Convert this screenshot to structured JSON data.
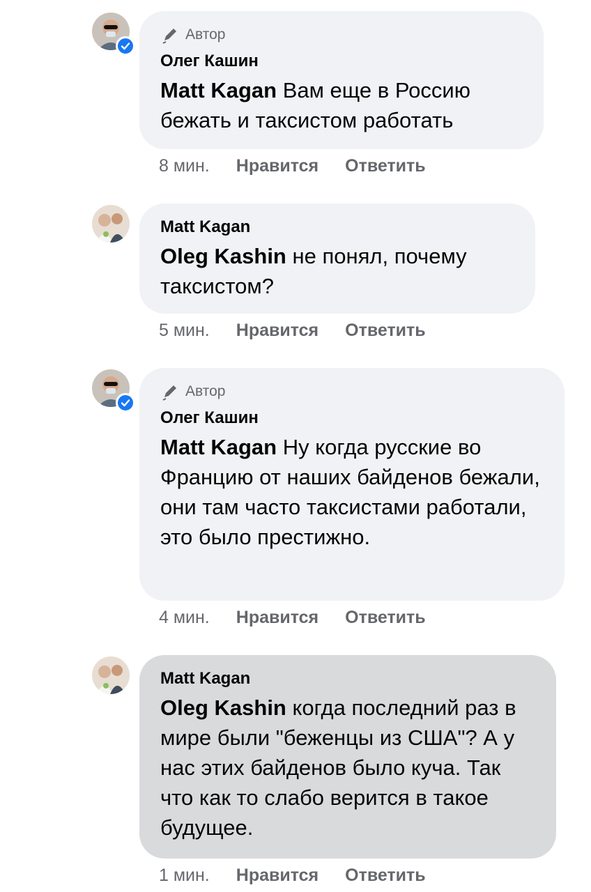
{
  "comments": [
    {
      "author_tag": "Автор",
      "name": "Олег Кашин",
      "mention": "Matt Kagan",
      "text": " Вам еще в Россию бежать и таксистом работать",
      "time": "8 мин.",
      "like": "Нравится",
      "reply": "Ответить"
    },
    {
      "name": "Matt Kagan",
      "mention": "Oleg Kashin",
      "text": " не понял, почему таксистом?",
      "time": "5 мин.",
      "like": "Нравится",
      "reply": "Ответить"
    },
    {
      "author_tag": "Автор",
      "name": "Олег Кашин",
      "mention": "Matt Kagan",
      "text": " Ну когда русские во Францию от наших байденов бежали, они там часто таксистами работали, это было престижно.",
      "time": "4 мин.",
      "like": "Нравится",
      "reply": "Ответить"
    },
    {
      "name": "Matt Kagan",
      "mention": "Oleg Kashin",
      "text": " когда последний раз в мире были \"беженцы из США\"? А у нас этих байденов было куча. Так что как то слабо верится в такое будущее.",
      "time": "1 мин.",
      "like": "Нравится",
      "reply": "Ответить"
    }
  ],
  "colors": {
    "bubble": "#f0f2f5",
    "bubble_selected": "#d9dadc",
    "meta_text": "#65676b",
    "verified": "#1877f2"
  }
}
